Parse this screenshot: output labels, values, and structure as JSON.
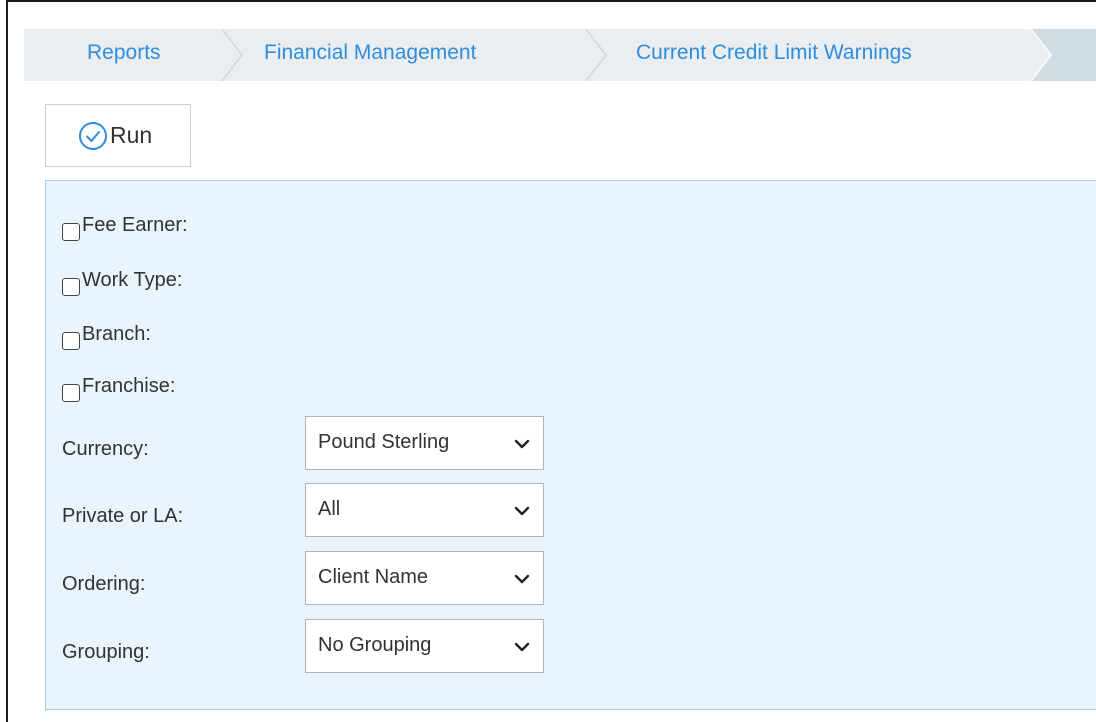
{
  "breadcrumb": {
    "items": [
      "Reports",
      "Financial Management",
      "Current Credit Limit Warnings"
    ],
    "link_color": "#2f8ddd",
    "background": "#ebeef0"
  },
  "toolbar": {
    "run_label": "Run",
    "run_icon": "check-circle-icon",
    "accent": "#2f8ddd"
  },
  "filters": {
    "checkboxes": [
      {
        "label": "Fee Earner:",
        "checked": false
      },
      {
        "label": "Work Type:",
        "checked": false
      },
      {
        "label": "Branch:",
        "checked": false
      },
      {
        "label": "Franchise:",
        "checked": false
      }
    ],
    "selects": [
      {
        "label": "Currency:",
        "value": "Pound Sterling"
      },
      {
        "label": "Private or LA:",
        "value": "All"
      },
      {
        "label": "Ordering:",
        "value": "Client Name"
      },
      {
        "label": "Grouping:",
        "value": "No Grouping"
      }
    ],
    "panel_background": "#eaf4fc",
    "panel_border": "#a5cde9"
  }
}
